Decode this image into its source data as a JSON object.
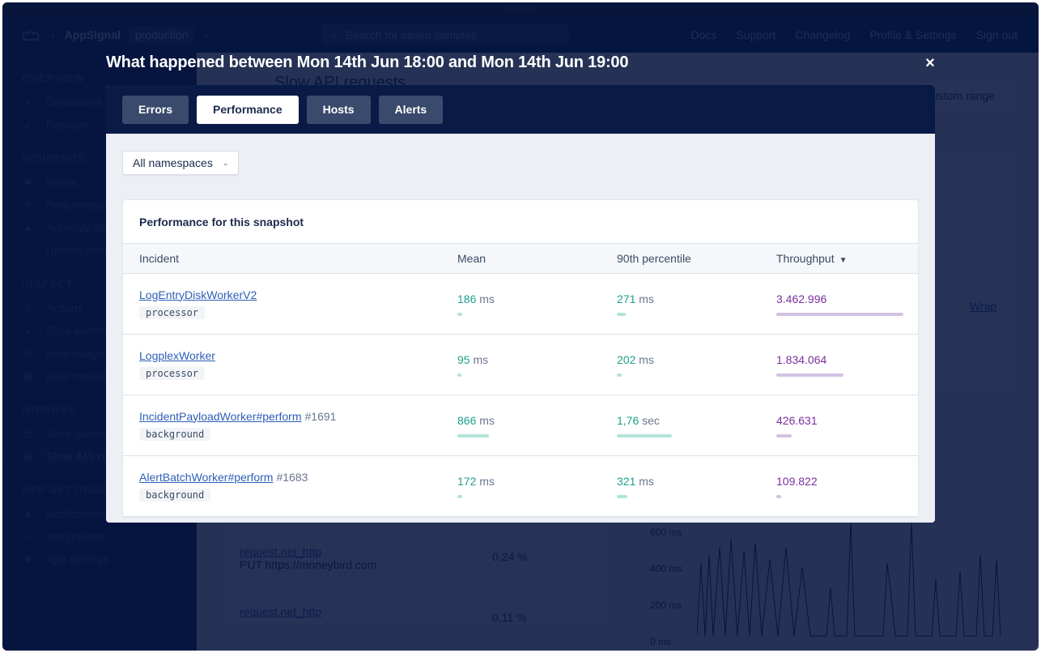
{
  "topbar": {
    "environment_banner": "Staging",
    "app_name": "AppSignal",
    "environment": "production",
    "search_placeholder": "Search for saved samples",
    "links": [
      "Docs",
      "Support",
      "Changelog",
      "Profile & Settings",
      "Sign out"
    ]
  },
  "sidebar": {
    "sections": [
      {
        "heading": "OVERVIEW",
        "items": [
          {
            "label": "Dashboard",
            "icon": "dashboard-icon"
          },
          {
            "label": "Deploys",
            "icon": "rocket-icon"
          }
        ]
      },
      {
        "heading": "INCIDENTS",
        "items": [
          {
            "label": "Errors",
            "icon": "bug-icon"
          },
          {
            "label": "Performance",
            "icon": "performance-icon"
          },
          {
            "label": "Anomaly detection",
            "icon": "bell-icon"
          },
          {
            "label": "Uptime monitoring",
            "icon": "traffic-light-icon"
          }
        ]
      },
      {
        "heading": "INSPECT",
        "items": [
          {
            "label": "Actions",
            "icon": "bolt-icon"
          },
          {
            "label": "Slow events",
            "icon": "turtle-icon"
          },
          {
            "label": "Host usage",
            "icon": "server-icon"
          },
          {
            "label": "Host metrics",
            "icon": "chip-icon"
          }
        ]
      },
      {
        "heading": "IMPROVE",
        "items": [
          {
            "label": "Slow queries",
            "icon": "database-icon"
          },
          {
            "label": "Slow API requests",
            "icon": "network-icon",
            "active": true
          }
        ]
      },
      {
        "heading": "APP SETTINGS",
        "items": [
          {
            "label": "Notifications",
            "icon": "bell-icon"
          },
          {
            "label": "Integrations",
            "icon": "link-icon"
          },
          {
            "label": "App settings",
            "icon": "gear-icon"
          }
        ]
      }
    ]
  },
  "background_page": {
    "title": "Slow API requests",
    "range_select": "Custom range",
    "wrap_link": "Wrap",
    "rows": [
      {
        "name": "request.net_http",
        "detail": "PUT https://moneybird.com",
        "pct": "0,24 %"
      },
      {
        "name": "request.net_http",
        "detail": "",
        "pct": "0,11 %"
      }
    ],
    "chart_axis": [
      "600 ms",
      "400 ms",
      "200 ms",
      "0 ms"
    ]
  },
  "modal": {
    "title": "What happened between Mon 14th Jun 18:00 and Mon 14th Jun 19:00",
    "close_label": "×",
    "tabs": [
      {
        "label": "Errors",
        "active": false
      },
      {
        "label": "Performance",
        "active": true
      },
      {
        "label": "Hosts",
        "active": false
      },
      {
        "label": "Alerts",
        "active": false
      }
    ],
    "namespace_select": "All namespaces",
    "card_title": "Performance for this snapshot",
    "columns": {
      "incident": "Incident",
      "mean": "Mean",
      "p90": "90th percentile",
      "throughput": "Throughput"
    },
    "rows": [
      {
        "name": "LogEntryDiskWorkerV2",
        "number": "",
        "namespace": "processor",
        "mean": "186",
        "mean_unit": "ms",
        "mean_frac": 0.04,
        "p90": "271",
        "p90_unit": "ms",
        "p90_frac": 0.07,
        "throughput": "3.462.996",
        "throughput_frac": 1.0
      },
      {
        "name": "LogplexWorker",
        "number": "",
        "namespace": "processor",
        "mean": "95",
        "mean_unit": "ms",
        "mean_frac": 0.03,
        "p90": "202",
        "p90_unit": "ms",
        "p90_frac": 0.04,
        "throughput": "1.834.064",
        "throughput_frac": 0.53
      },
      {
        "name": "IncidentPayloadWorker#perform",
        "number": "#1691",
        "namespace": "background",
        "mean": "866",
        "mean_unit": "ms",
        "mean_frac": 0.25,
        "p90": "1,76",
        "p90_unit": "sec",
        "p90_frac": 0.43,
        "throughput": "426.631",
        "throughput_frac": 0.12
      },
      {
        "name": "AlertBatchWorker#perform",
        "number": "#1683",
        "namespace": "background",
        "mean": "172",
        "mean_unit": "ms",
        "mean_frac": 0.04,
        "p90": "321",
        "p90_unit": "ms",
        "p90_frac": 0.08,
        "throughput": "109.822",
        "throughput_frac": 0.04
      }
    ]
  }
}
